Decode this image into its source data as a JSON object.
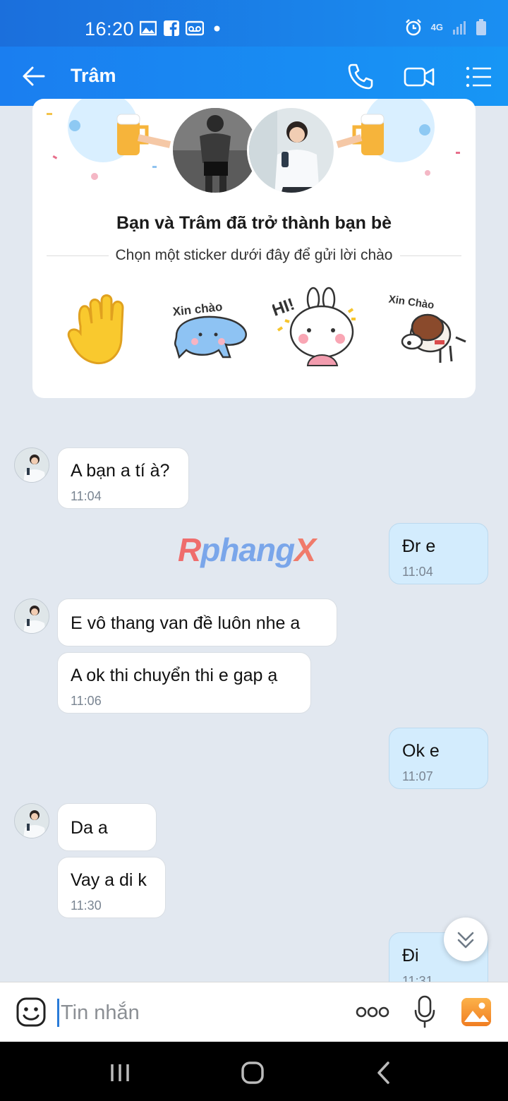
{
  "status_bar": {
    "time": "16:20",
    "network": "4G"
  },
  "header": {
    "contact_name": "Trâm"
  },
  "friend_card": {
    "headline": "Bạn và Trâm đã trở thành bạn bè",
    "subtitle": "Chọn một sticker dưới đây để gửi lời chào",
    "stickers": [
      {
        "icon": "waving-hand-icon"
      },
      {
        "caption": "Xin chào",
        "icon": "blue-blob-sticker"
      },
      {
        "caption": "HI!",
        "icon": "bunny-sticker"
      },
      {
        "caption": "Xin Chào",
        "icon": "dog-sticker"
      }
    ]
  },
  "watermark": {
    "part1": "R",
    "part2": "phang",
    "part3": "X"
  },
  "messages": [
    {
      "direction": "in",
      "text": "A bạn a tí à?",
      "time": "11:04"
    },
    {
      "direction": "out",
      "text": "Đr e",
      "time": "11:04"
    },
    {
      "direction": "in",
      "text": " E vô thang van đề luôn nhe a",
      "time": ""
    },
    {
      "direction": "in",
      "text": "A ok thi chuyển thi e gap ạ",
      "time": "11:06"
    },
    {
      "direction": "out",
      "text": "Ok e",
      "time": "11:07"
    },
    {
      "direction": "in",
      "text": "Da a",
      "time": ""
    },
    {
      "direction": "in",
      "text": "Vay a di k",
      "time": "11:30"
    },
    {
      "direction": "out",
      "text": "Đi",
      "time": "11:31"
    }
  ],
  "input": {
    "placeholder": "Tin nhắn",
    "value": ""
  },
  "colors": {
    "header": "#1a8ff2",
    "bubble_out": "#d3ecfd",
    "bubble_in": "#ffffff",
    "background": "#e2e8f0",
    "accent": "#2a7bd8"
  }
}
